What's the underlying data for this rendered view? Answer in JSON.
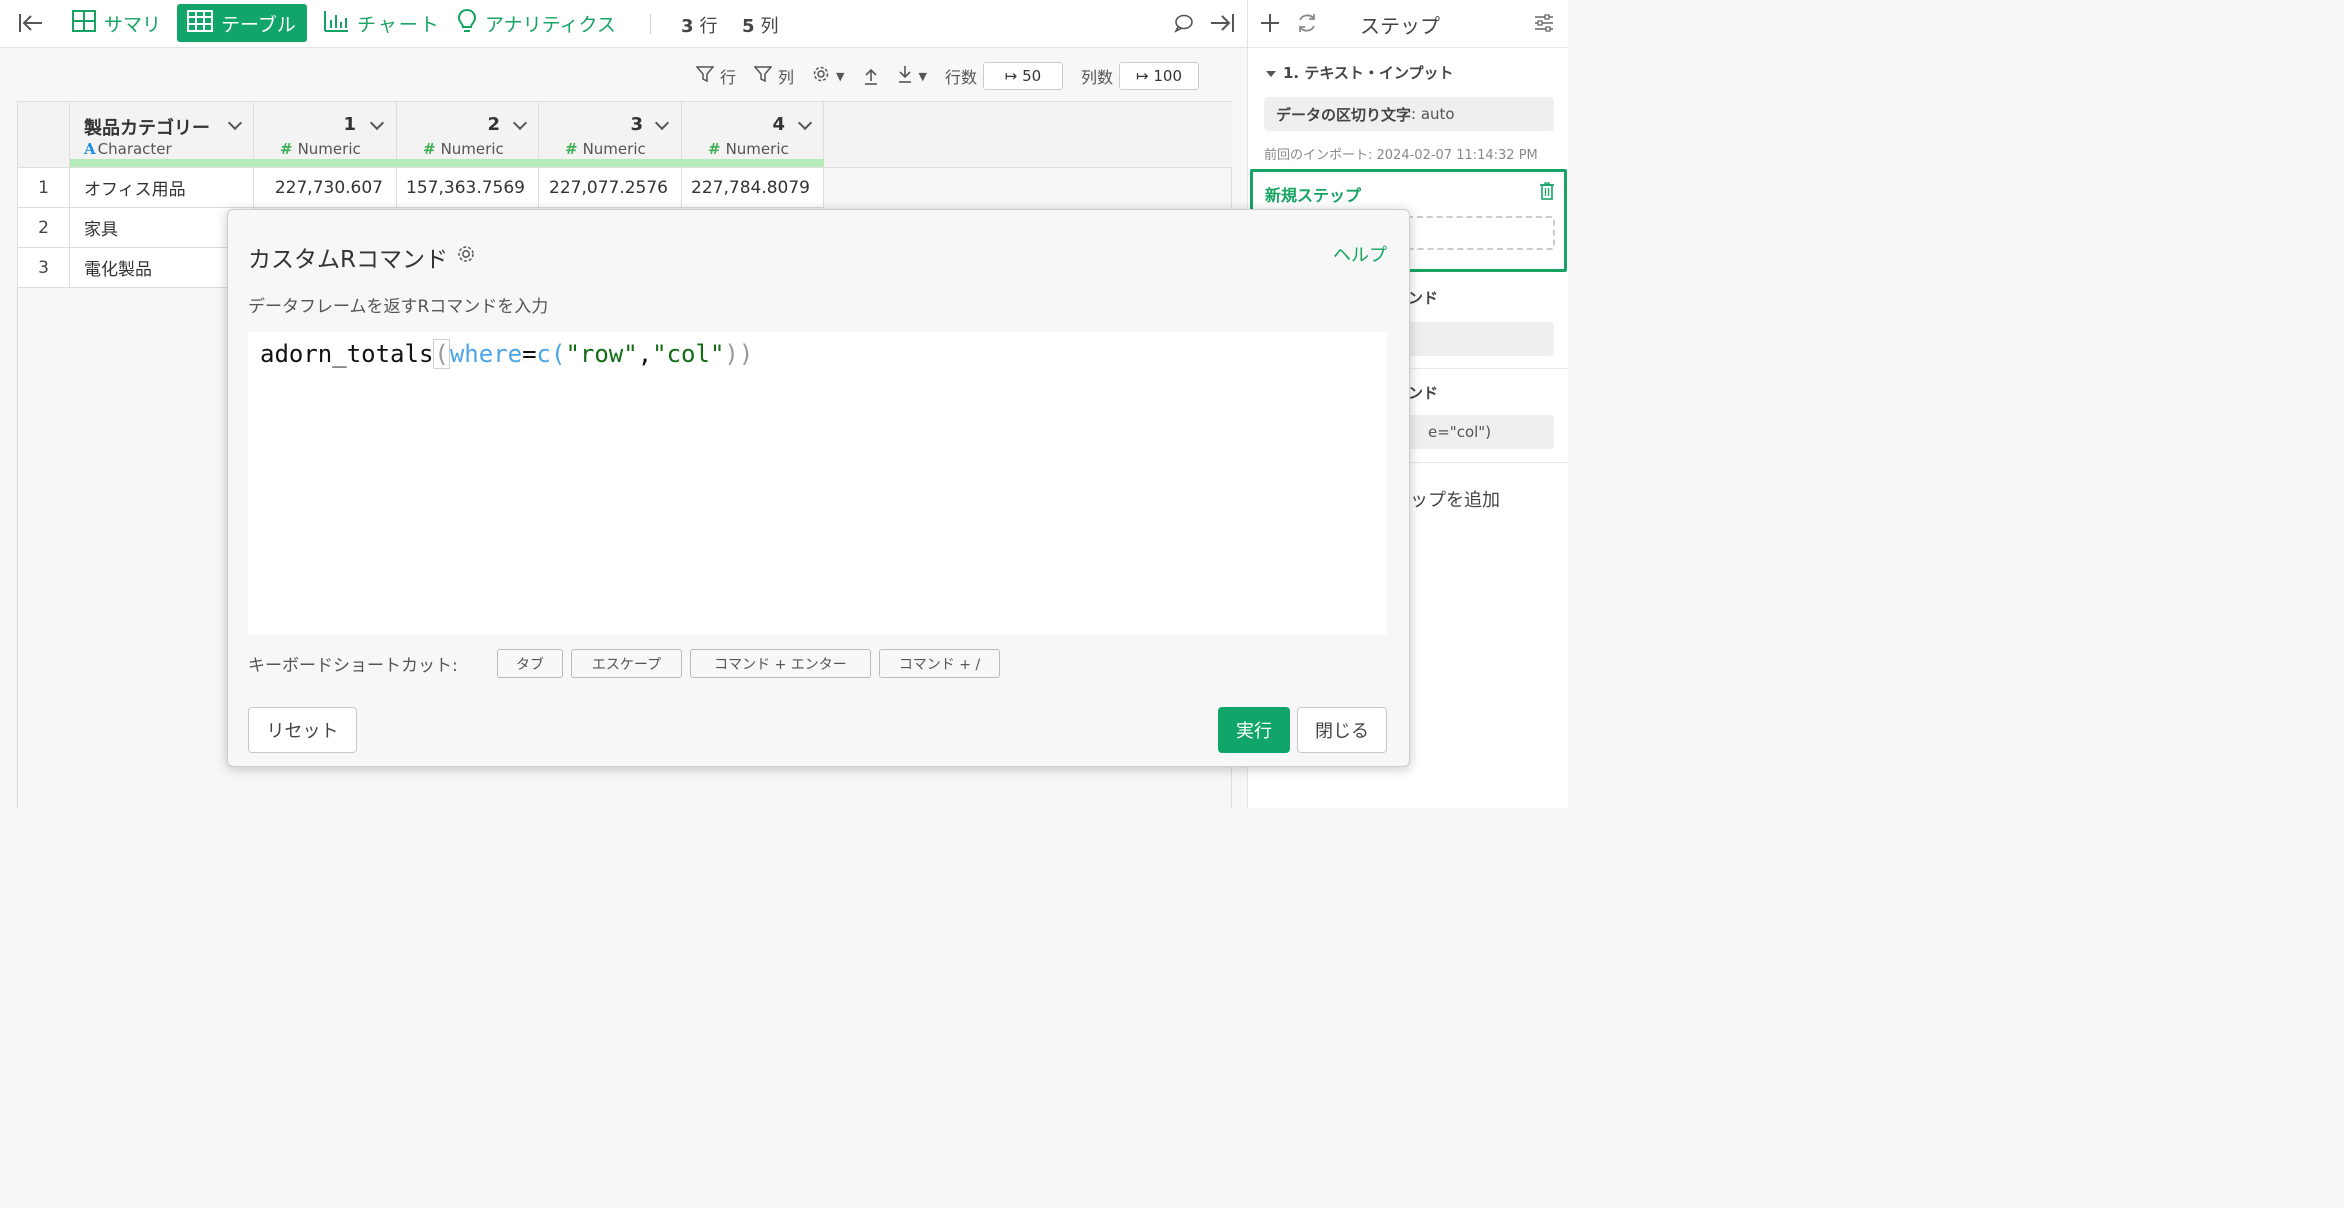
{
  "toolbar": {
    "tabs": [
      {
        "label": "サマリ"
      },
      {
        "label": "テーブル"
      },
      {
        "label": "チャート"
      },
      {
        "label": "アナリティクス"
      }
    ],
    "rows_count": "3",
    "rows_unit": "行",
    "cols_count": "5",
    "cols_unit": "列"
  },
  "subbar": {
    "row_filter": "行",
    "col_filter": "列",
    "rows_label": "行数",
    "rows_value": "↦ 50",
    "cols_label": "列数",
    "cols_value": "↦ 100"
  },
  "table": {
    "columns": [
      {
        "name": "製品カテゴリー",
        "type": "Character",
        "type_icon": "A"
      },
      {
        "name": "1",
        "type": "Numeric",
        "type_icon": "#"
      },
      {
        "name": "2",
        "type": "Numeric",
        "type_icon": "#"
      },
      {
        "name": "3",
        "type": "Numeric",
        "type_icon": "#"
      },
      {
        "name": "4",
        "type": "Numeric",
        "type_icon": "#"
      }
    ],
    "rows": [
      {
        "num": "1",
        "cells": [
          "オフィス用品",
          "227,730.607",
          "157,363.7569",
          "227,077.2576",
          "227,784.8079"
        ]
      },
      {
        "num": "2",
        "cells": [
          "家具"
        ]
      },
      {
        "num": "3",
        "cells": [
          "電化製品"
        ]
      }
    ]
  },
  "steps_panel": {
    "title": "ステップ",
    "step1_title": "1. テキスト・インプット",
    "step1_chip_key": "データの区切り文字",
    "step1_chip_value": ": auto",
    "step1_note": "前回のインポート: 2024-02-07 11:14:32 PM",
    "new_step_label": "新規ステップ",
    "partial_step2": "ンド",
    "partial_step3": "ンド",
    "partial_step3_chip": "e=\"col\")",
    "partial_add": "ップを追加"
  },
  "modal": {
    "title": "カスタムRコマンド",
    "help": "ヘルプ",
    "description": "データフレームを返すRコマンドを入力",
    "code": {
      "fn": "adorn_totals",
      "open": "(",
      "arg": "where",
      "eq": "=",
      "c": "c",
      "p1": "(",
      "s1": "\"row\"",
      "comma": ",",
      "s2": "\"col\"",
      "p2": ")",
      "p3": ")"
    },
    "shortcuts_label": "キーボードショートカット:",
    "shortcuts": [
      "タブ",
      "エスケープ",
      "コマンド + エンター",
      "コマンド + /"
    ],
    "reset": "リセット",
    "run": "実行",
    "close": "閉じる"
  },
  "colors": {
    "accent": "#17a463",
    "accent_fill": "#12a56a",
    "column_bar": "#b6eab8",
    "numeric_icon": "#3fae55",
    "character_icon": "#1b8be0"
  },
  "icons": [
    "collapse-left-icon",
    "summary-grid-icon",
    "table-icon",
    "bar-chart-icon",
    "lightbulb-icon",
    "comment-icon",
    "expand-right-icon",
    "plus-icon",
    "refresh-icon",
    "sliders-icon",
    "filter-icon",
    "gear-icon",
    "sort-up-icon",
    "sort-down-icon",
    "trash-icon"
  ]
}
